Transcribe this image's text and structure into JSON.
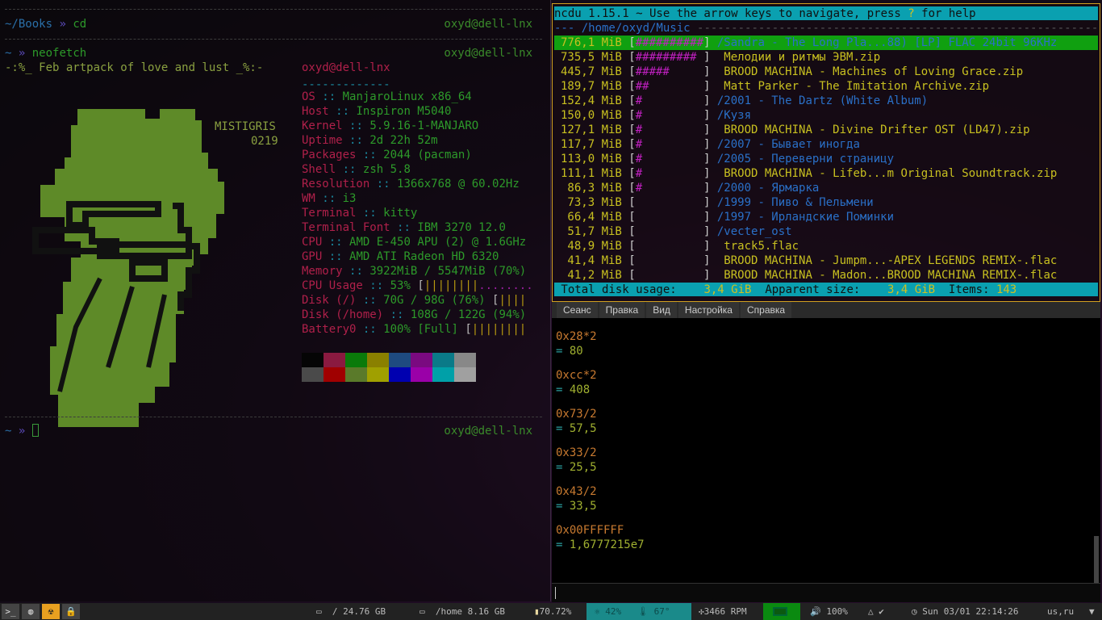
{
  "left_terminal": {
    "prompt1": {
      "path": "~/Books",
      "arrow": "»",
      "cmd": "cd",
      "host": "oxyd@dell-lnx"
    },
    "prompt2": {
      "path": "~",
      "arrow": "»",
      "cmd": "neofetch",
      "host": "oxyd@dell-lnx"
    },
    "art_title": "-:%_ Feb artpack of love and lust _%:-",
    "art_tag1": "MISTIGRIS",
    "art_tag2": "0219",
    "user_host": "oxyd@dell-lnx",
    "underline": "-------------",
    "info": [
      {
        "k": "OS",
        "v": "ManjaroLinux x86_64"
      },
      {
        "k": "Host",
        "v": "Inspiron M5040"
      },
      {
        "k": "Kernel",
        "v": "5.9.16-1-MANJARO"
      },
      {
        "k": "Uptime",
        "v": "2d 22h 52m"
      },
      {
        "k": "Packages",
        "v": "2044 (pacman)"
      },
      {
        "k": "Shell",
        "v": "zsh 5.8"
      },
      {
        "k": "Resolution",
        "v": "1366x768 @ 60.02Hz"
      },
      {
        "k": "WM",
        "v": "i3"
      },
      {
        "k": "Terminal",
        "v": "kitty"
      },
      {
        "k": "Terminal Font",
        "v": "IBM 3270 12.0"
      },
      {
        "k": "CPU",
        "v": "AMD E-450 APU (2) @ 1.6GHz"
      },
      {
        "k": "GPU",
        "v": "AMD ATI Radeon HD 6320"
      },
      {
        "k": "Memory",
        "v": "3922MiB / 5547MiB (70%)"
      },
      {
        "k": "CPU Usage",
        "v": "53%",
        "bar": "||||||||",
        "bar_rest": "........"
      },
      {
        "k": "Disk (/)",
        "v": "70G / 98G (76%)",
        "bar": "||||"
      },
      {
        "k": "Disk (/home)",
        "v": "108G / 122G (94%)"
      },
      {
        "k": "Battery0",
        "v": "100% [Full]",
        "bar": "||||||||"
      }
    ],
    "sep": "::",
    "palette": [
      "#050505",
      "#8a1a40",
      "#0a7a0a",
      "#8a8000",
      "#1e4a80",
      "#7a0a80",
      "#0a7a88",
      "#888888",
      "#4a4a4a",
      "#a00000",
      "#5a7a2a",
      "#a0a000",
      "#0000b0",
      "#9a00a8",
      "#00a0a8",
      "#a0a0a0"
    ],
    "prompt3": {
      "path": "~",
      "arrow": "»",
      "host": "oxyd@dell-lnx"
    }
  },
  "ncdu": {
    "header": "ncdu 1.15.1 ~ Use the arrow keys to navigate, press ? for help",
    "header_pre": "ncdu 1.15.1 ~ Use the arrow keys to navigate, press ",
    "header_q": "?",
    "header_post": " for help",
    "path_line": "--- /home/oxyd/Music ",
    "rows": [
      {
        "size": "776,1 MiB",
        "bar": "##########",
        "name": "/Sandra - The Long Pla...88) [LP] FLAC 24bit 96KHz",
        "type": "dir",
        "selected": true
      },
      {
        "size": "735,5 MiB",
        "bar": "######### ",
        "name": " Мелодии и ритмы ЭВМ.zip",
        "type": "file"
      },
      {
        "size": "445,7 MiB",
        "bar": "#####     ",
        "name": " BROOD MACHINA - Machines of Loving Grace.zip",
        "type": "file"
      },
      {
        "size": "189,7 MiB",
        "bar": "##        ",
        "name": " Matt Parker - The Imitation Archive.zip",
        "type": "file"
      },
      {
        "size": "152,4 MiB",
        "bar": "#         ",
        "name": "/2001 - The Dartz (White Album)",
        "type": "dir"
      },
      {
        "size": "150,0 MiB",
        "bar": "#         ",
        "name": "/Кузя",
        "type": "dir"
      },
      {
        "size": "127,1 MiB",
        "bar": "#         ",
        "name": " BROOD MACHINA - Divine Drifter OST (LD47).zip",
        "type": "file"
      },
      {
        "size": "117,7 MiB",
        "bar": "#         ",
        "name": "/2007 - Бывает иногда",
        "type": "dir"
      },
      {
        "size": "113,0 MiB",
        "bar": "#         ",
        "name": "/2005 - Переверни страницу",
        "type": "dir"
      },
      {
        "size": "111,1 MiB",
        "bar": "#         ",
        "name": " BROOD MACHINA - Lifeb...m Original Soundtrack.zip",
        "type": "file"
      },
      {
        "size": " 86,3 MiB",
        "bar": "#         ",
        "name": "/2000 - Ярмарка",
        "type": "dir"
      },
      {
        "size": " 73,3 MiB",
        "bar": "          ",
        "name": "/1999 - Пиво & Пельмени",
        "type": "dir"
      },
      {
        "size": " 66,4 MiB",
        "bar": "          ",
        "name": "/1997 - Ирландские Поминки",
        "type": "dir"
      },
      {
        "size": " 51,7 MiB",
        "bar": "          ",
        "name": "/vecter_ost",
        "type": "dir"
      },
      {
        "size": " 48,9 MiB",
        "bar": "          ",
        "name": " track5.flac",
        "type": "file"
      },
      {
        "size": " 41,4 MiB",
        "bar": "          ",
        "name": " BROOD MACHINA - Jumpm...-APEX LEGENDS REMIX-.flac",
        "type": "file"
      },
      {
        "size": " 41,2 MiB",
        "bar": "          ",
        "name": " BROOD MACHINA - Madon...BROOD MACHINA REMIX-.flac",
        "type": "file"
      }
    ],
    "footer": {
      "total_label": " Total disk usage:",
      "total": "3,4 GiB",
      "apparent_label": "Apparent size:",
      "apparent": "3,4 GiB",
      "items_label": "Items:",
      "items": "143"
    }
  },
  "konsole": {
    "menu": [
      "Сеанс",
      "Правка",
      "Вид",
      "Настройка",
      "Справка"
    ],
    "entries": [
      {
        "expr": "0x28*2",
        "result": "80"
      },
      {
        "expr": "0xcc*2",
        "result": "408"
      },
      {
        "expr": "0x73/2",
        "result": "57,5"
      },
      {
        "expr": "0x33/2",
        "result": "25,5"
      },
      {
        "expr": "0x43/2",
        "result": "33,5"
      },
      {
        "expr": "0x00FFFFFF",
        "result": "1,6777215e7"
      }
    ],
    "eq": "="
  },
  "statusbar": {
    "workspaces": [
      {
        "icon": "terminal-icon",
        "glyph": ">_"
      },
      {
        "icon": "globe-icon",
        "glyph": "◍"
      },
      {
        "icon": "radiation-icon",
        "glyph": "☢",
        "active": true
      },
      {
        "icon": "lock-icon",
        "glyph": "🔒"
      }
    ],
    "disk_root": "/ 24.76 GB",
    "disk_home": "/home 8.16 GB",
    "memory": "70.72%",
    "cpu": "42%",
    "temp": "67°",
    "fan": "3466 RPM",
    "volume": "100%",
    "datetime": "Sun 03/01 22:14:26",
    "layout": "us,ru",
    "colors": {
      "teal": "#1a8a8a",
      "green": "#0a8a10",
      "bg": "#222222"
    }
  }
}
